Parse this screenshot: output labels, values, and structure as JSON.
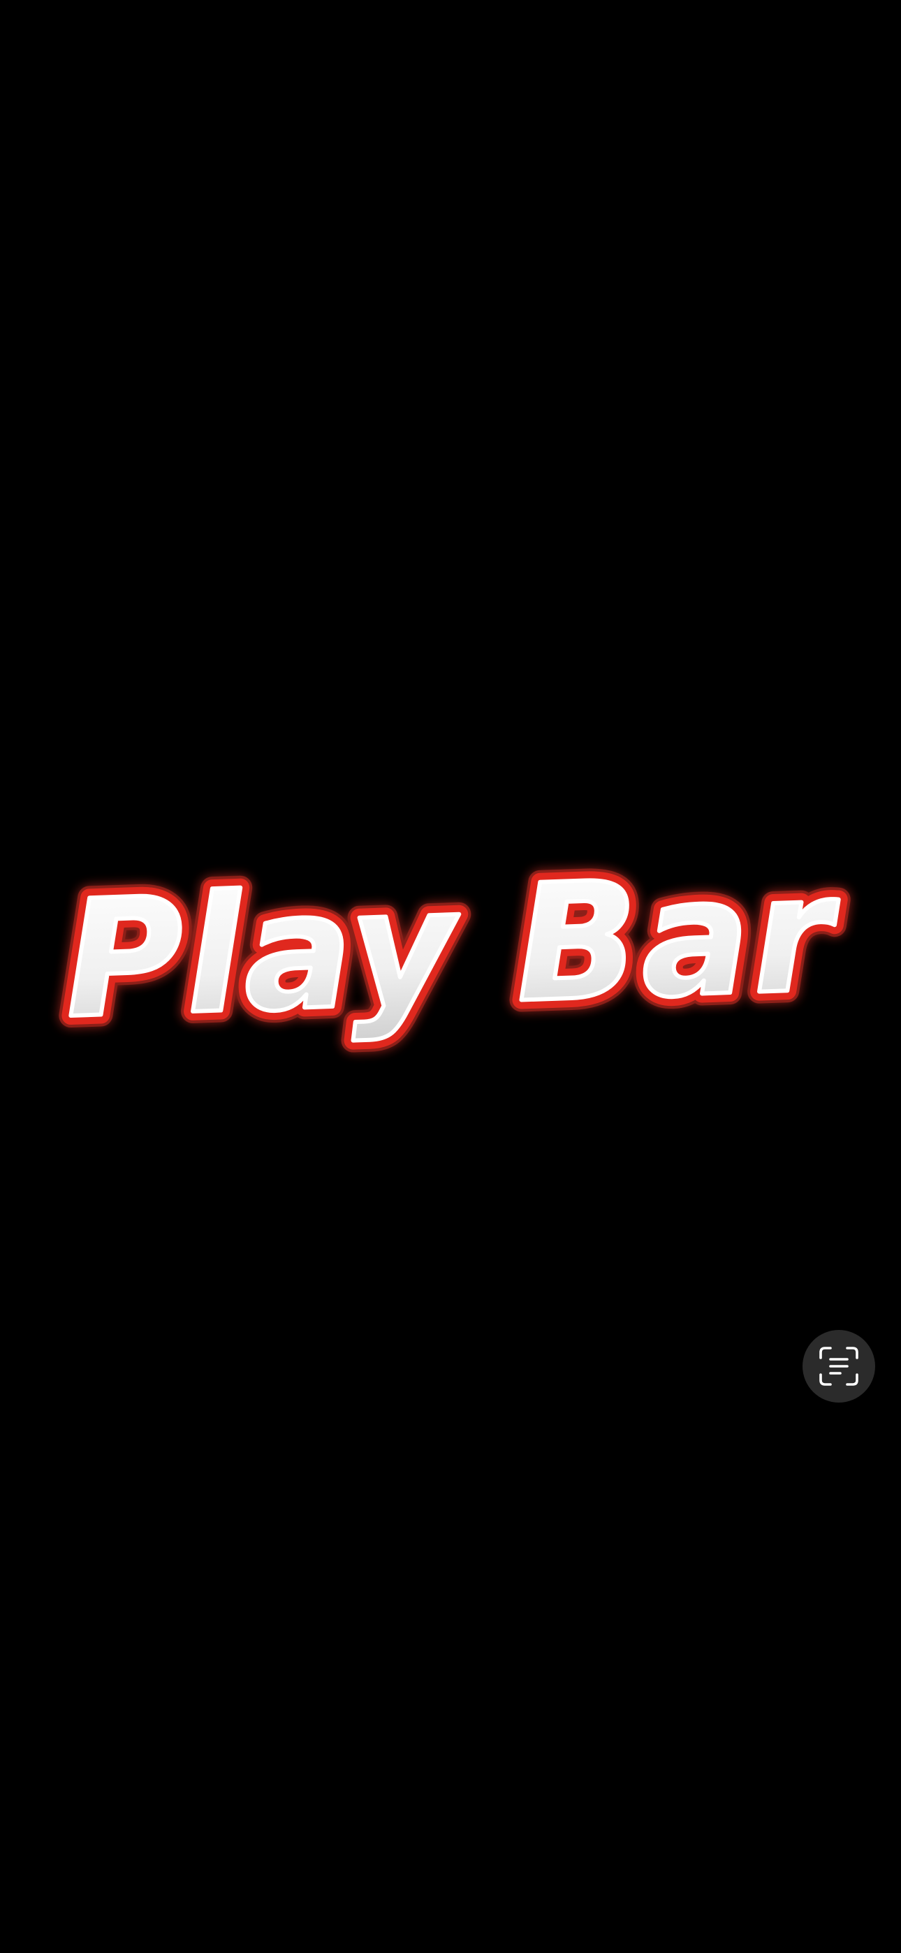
{
  "logo": {
    "text": "Play Bar",
    "fill_color": "#f4f4f4",
    "outline_color": "#e0281e",
    "glow_color": "#ff3b2f"
  },
  "scan_button": {
    "icon": "text-scan-icon",
    "background_color": "#2b2b2b",
    "icon_color": "#ffffff"
  }
}
